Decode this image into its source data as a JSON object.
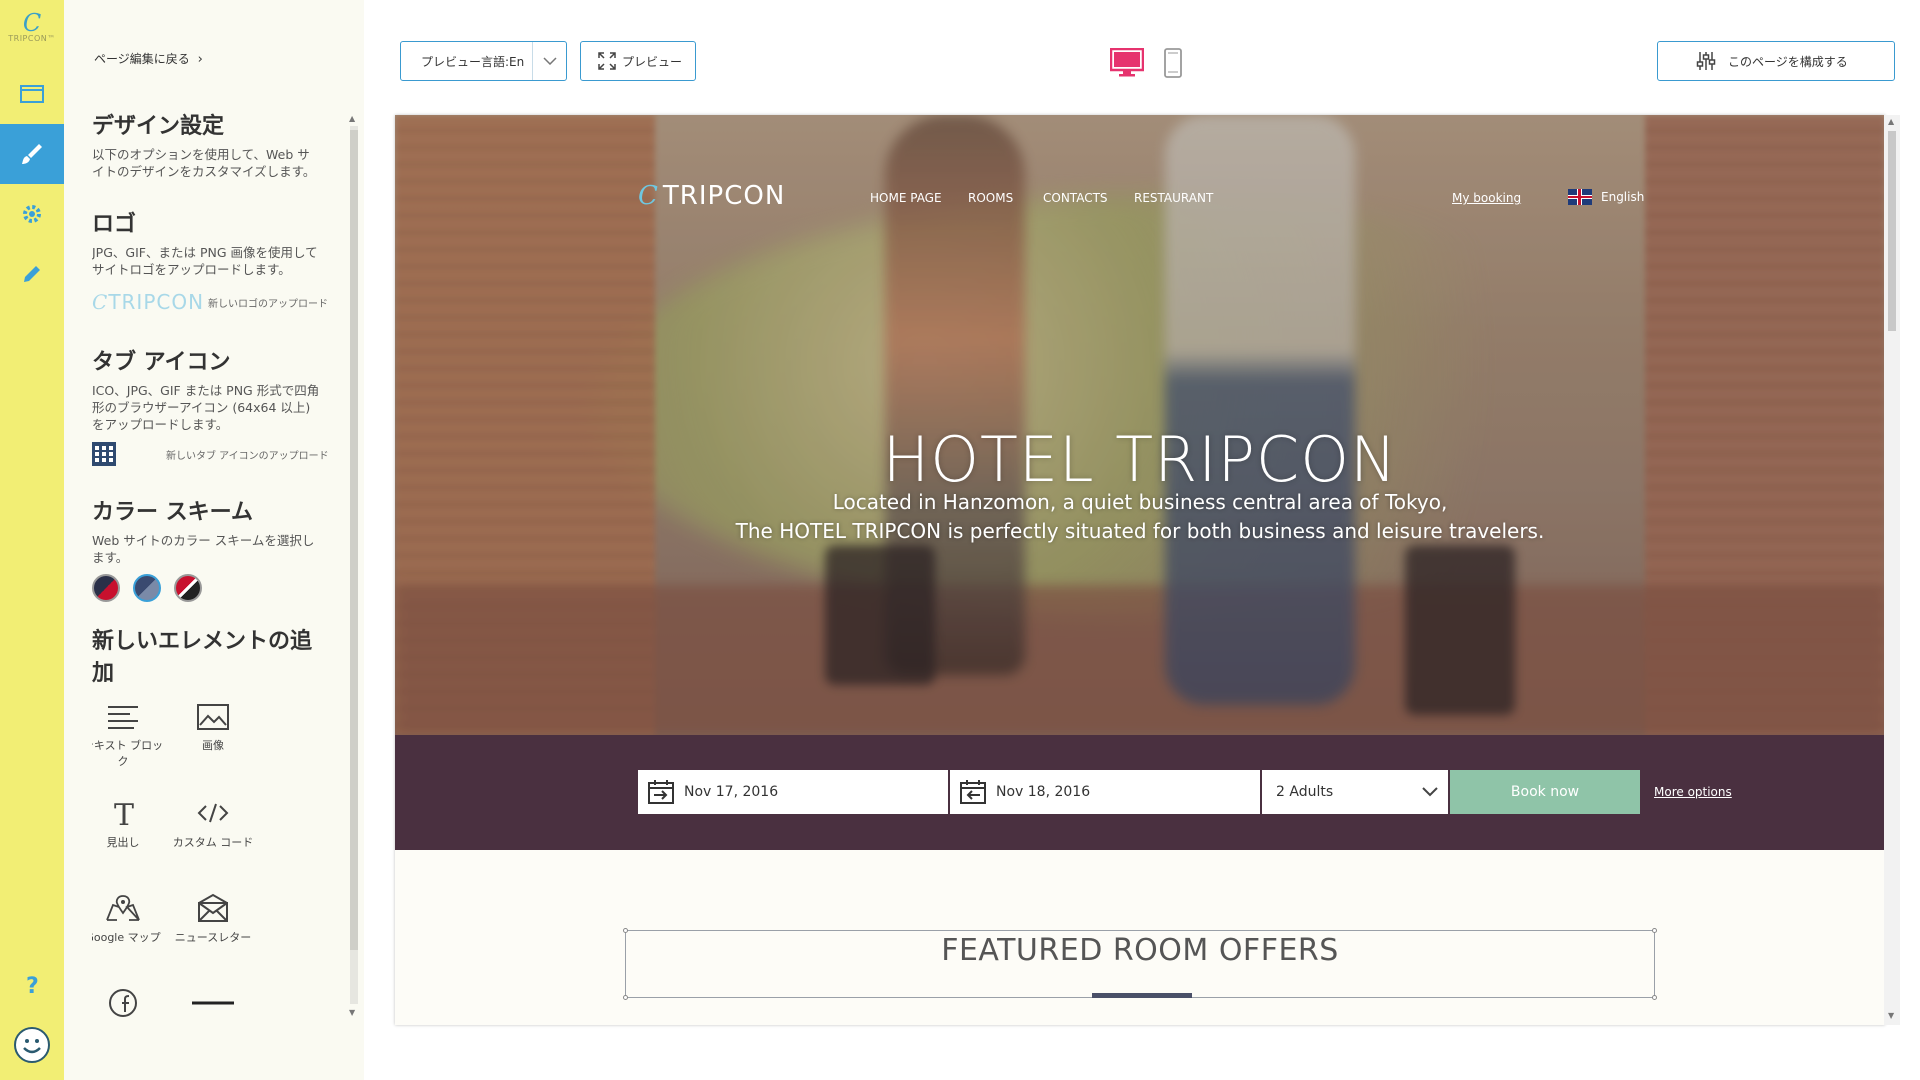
{
  "rail": {
    "logo_text": "TRIPCON™",
    "icons": [
      "layout-icon",
      "brush-icon",
      "gear-icon",
      "pencil-icon",
      "help-icon",
      "smiley-icon"
    ],
    "accent": "#3aa0d8",
    "background": "#f2ee74"
  },
  "panel": {
    "back_link": "ページ編集に戻る",
    "design": {
      "title": "デザイン設定",
      "desc": "以下のオプションを使用して、Web サイトのデザインをカスタマイズします。"
    },
    "logo": {
      "title": "ロゴ",
      "desc": "JPG、GIF、または PNG 画像を使用してサイトロゴをアップロードします。",
      "preview_text": "TRIPCON",
      "upload_label": "新しいロゴのアップロード"
    },
    "tab_icon": {
      "title": "タブ アイコン",
      "desc": "ICO、JPG、GIF または PNG 形式で四角形のブラウザーアイコン (64x64 以上) をアップロードします。",
      "upload_label": "新しいタブ アイコンのアップロード"
    },
    "color_scheme": {
      "title": "カラー スキーム",
      "desc": "Web サイトのカラー スキームを選択します。",
      "swatches": [
        {
          "name": "scheme-dark-red",
          "colors": [
            "#2a3048",
            "#c8102e"
          ]
        },
        {
          "name": "scheme-blue-gray",
          "colors": [
            "#3a4a70",
            "#7a8aa8"
          ]
        },
        {
          "name": "scheme-red-black",
          "colors": [
            "#c8102e",
            "#222222"
          ]
        }
      ]
    },
    "add_element": {
      "title": "新しいエレメントの追加",
      "items": [
        {
          "label": "テキスト ブロック",
          "icon": "text-block-icon"
        },
        {
          "label": "画像",
          "icon": "image-icon"
        },
        {
          "label": "見出し",
          "icon": "heading-icon"
        },
        {
          "label": "カスタム コード",
          "icon": "code-icon"
        },
        {
          "label": "Google マップ",
          "icon": "map-icon"
        },
        {
          "label": "ニュースレター",
          "icon": "newsletter-icon"
        },
        {
          "label": "",
          "icon": "facebook-icon"
        },
        {
          "label": "",
          "icon": "divider-icon"
        }
      ]
    }
  },
  "toolbar": {
    "preview_lang": "プレビュー言語:En",
    "preview": "プレビュー",
    "configure": "このページを構成する",
    "accent": "#3a9ad0",
    "device_active": "desktop",
    "device_active_color": "#e6336e"
  },
  "site": {
    "logo": "TRIPCON",
    "nav": [
      "HOME PAGE",
      "ROOMS",
      "CONTACTS",
      "RESTAURANT"
    ],
    "my_booking": "My booking",
    "language": "English",
    "hero_title": "HOTEL TRIPCON",
    "hero_line1": "Located in Hanzomon, a quiet business central area of Tokyo,",
    "hero_line2": "The HOTEL TRIPCON is perfectly situated for both business and leisure travelers.",
    "checkin": "Nov 17, 2016",
    "checkout": "Nov 18, 2016",
    "guests": "2 Adults",
    "book_now": "Book now",
    "more_options": "More options",
    "featured_heading": "FEATURED ROOM OFFERS",
    "booking_bar_color": "#4a3040",
    "book_button_color": "#8fc4a8"
  }
}
